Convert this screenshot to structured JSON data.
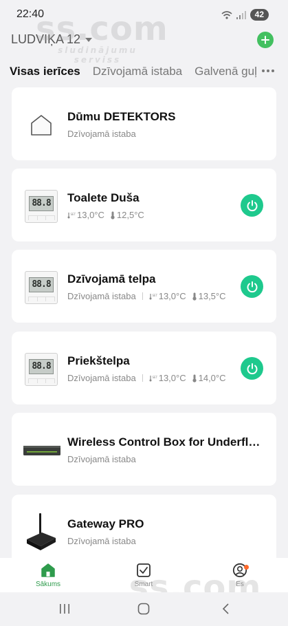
{
  "status_bar": {
    "time": "22:40",
    "battery": "42"
  },
  "header": {
    "home_name": "LUDVIĶA 12"
  },
  "tabs": [
    "Visas ierīces",
    "Dzīvojamā istaba",
    "Galvenā guļ"
  ],
  "devices": [
    {
      "name": "Dūmu DETEKTORS",
      "room": "Dzīvojamā istaba"
    },
    {
      "name": "Toalete Duša",
      "set_temp": "13,0°C",
      "temp": "12,5°C",
      "power": "on"
    },
    {
      "name": "Dzīvojamā telpa",
      "room": "Dzīvojamā istaba",
      "set_temp": "13,0°C",
      "temp": "13,5°C",
      "power": "on"
    },
    {
      "name": "Priekštelpa",
      "room": "Dzīvojamā istaba",
      "set_temp": "13,0°C",
      "temp": "14,0°C",
      "power": "on"
    },
    {
      "name": "Wireless Control Box for Underfloor...",
      "room": "Dzīvojamā istaba"
    },
    {
      "name": "Gateway PRO",
      "room": "Dzīvojamā istaba"
    }
  ],
  "thermostat_display": "88.8",
  "bottom_nav": [
    {
      "label": "Sākums",
      "icon": "home-icon",
      "active": true
    },
    {
      "label": "Smart",
      "icon": "smart-checkbox-icon",
      "active": false
    },
    {
      "label": "Es",
      "icon": "profile-icon",
      "active": false
    }
  ],
  "watermark": {
    "big": "ss.com",
    "small": "sludinājumu serviss"
  },
  "colors": {
    "accent_green": "#43c060",
    "power_green": "#1ec98d",
    "nav_active": "#2e9b4c",
    "notification": "#ff6a2b"
  }
}
